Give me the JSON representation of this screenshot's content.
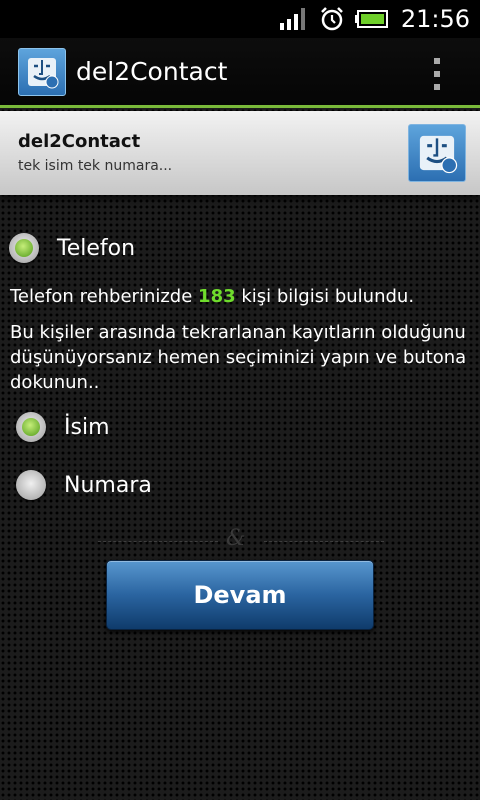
{
  "status_bar": {
    "time": "21:56",
    "icons": [
      "signal-icon",
      "alarm-icon",
      "battery-icon"
    ]
  },
  "action_bar": {
    "title": "del2Contact",
    "accent_color": "#7aba3a"
  },
  "header": {
    "title": "del2Contact",
    "subtitle": "tek isim tek numara..."
  },
  "content": {
    "source_option": {
      "label": "Telefon",
      "selected": true
    },
    "found_prefix": "Telefon rehberinizde ",
    "found_count": "183",
    "found_suffix": " kişi bilgisi bulundu.",
    "instruction": "Bu kişiler arasında tekrarlanan kayıtların olduğunu düşünüyorsanız hemen seçiminizi yapın ve butona dokunun..",
    "options": [
      {
        "label": "İsim",
        "selected": true
      },
      {
        "label": "Numara",
        "selected": false
      }
    ],
    "divider_symbol": "&",
    "button_label": "Devam"
  }
}
